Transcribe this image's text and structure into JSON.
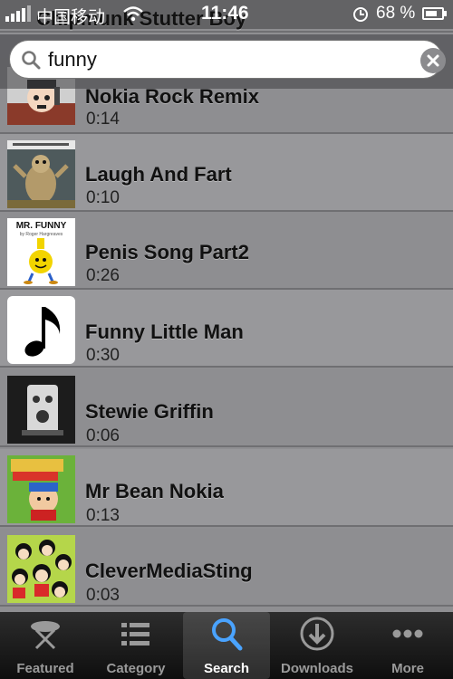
{
  "status_bar": {
    "carrier": "中国移动",
    "time": "11:46",
    "battery_percent": "68 %"
  },
  "search": {
    "value": "funny"
  },
  "header_partial_title": "Chipmunk Stutter Boy",
  "results": [
    {
      "title": "Nokia Rock Remix",
      "duration": "0:14"
    },
    {
      "title": "Laugh And Fart",
      "duration": "0:10"
    },
    {
      "title": "Penis Song Part2",
      "duration": "0:26"
    },
    {
      "title": "Funny Little Man",
      "duration": "0:30"
    },
    {
      "title": "Stewie Griffin",
      "duration": "0:06"
    },
    {
      "title": "Mr Bean Nokia",
      "duration": "0:13"
    },
    {
      "title": "CleverMediaSting",
      "duration": "0:03"
    }
  ],
  "thumb_texts": {
    "mr_funny": "MR. FUNNY",
    "mr_funny_sub": "by Roger Hargreaves"
  },
  "tabs": [
    {
      "label": "Featured",
      "icon": "featured-icon",
      "active": false
    },
    {
      "label": "Category",
      "icon": "list-icon",
      "active": false
    },
    {
      "label": "Search",
      "icon": "search-icon",
      "active": true
    },
    {
      "label": "Downloads",
      "icon": "download-icon",
      "active": false
    },
    {
      "label": "More",
      "icon": "more-icon",
      "active": false
    }
  ],
  "colors": {
    "row_bg": "#8e8e91",
    "row_alt_bg": "#98989b",
    "tab_active_icon": "#4aa3ff"
  }
}
